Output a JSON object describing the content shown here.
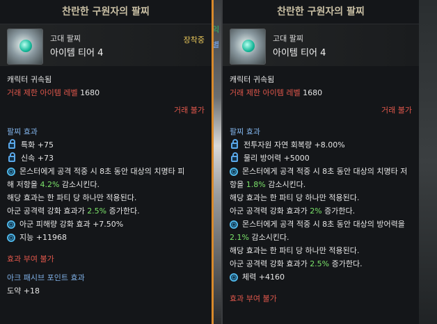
{
  "background": {
    "left_fragment": "익",
    "blue_fragment": "별"
  },
  "left": {
    "title": "찬란한 구원자의 팔찌",
    "grade": "고대 팔찌",
    "tier": "아이템 티어 4",
    "equipped": "장착중",
    "bound": "캐릭터 귀속됨",
    "level_label": "거래 제한 아이템 레벨",
    "level_value": "1680",
    "trade": "거래 불가",
    "effects_title": "팔찌 효과",
    "stat1": "특화 +75",
    "stat2": "신속 +73",
    "eff1_a": "몬스터에게 공격 적중 시 8초 동안 대상의 치명타 피",
    "eff1_b_pre": "해 저항을 ",
    "eff1_b_val": "4.2%",
    "eff1_b_post": " 감소시킨다.",
    "eff1_c": "해당 효과는 한 파티 당 하나만 적용된다.",
    "eff1_d_pre": "아군 공격력 강화 효과가 ",
    "eff1_d_val": "2.5%",
    "eff1_d_post": " 증가한다.",
    "eff2": "아군 피해량 강화 효과 +7.50%",
    "eff3": "지능 +11968",
    "enchant": "효과 부여 불가",
    "ark_title": "아크 패시브 포인트 효과",
    "ark_value": "도약 +18"
  },
  "right": {
    "title": "찬란한 구원자의 팔찌",
    "grade": "고대 팔찌",
    "tier": "아이템 티어 4",
    "bound": "캐릭터 귀속됨",
    "level_label": "거래 제한 아이템 레벨",
    "level_value": "1680",
    "trade": "거래 불가",
    "effects_title": "팔찌 효과",
    "stat1": "전투자원 자연 회복량 +8.00%",
    "stat2": "물리 방어력 +5000",
    "eff1_a": "몬스터에게 공격 적중 시 8초 동안 대상의 치명타 저",
    "eff1_b_pre": "항을 ",
    "eff1_b_val": "1.8%",
    "eff1_b_post": " 감소시킨다.",
    "eff1_c": "해당 효과는 한 파티 당 하나만 적용된다.",
    "eff1_d_pre": "아군 공격력 강화 효과가 ",
    "eff1_d_val": "2%",
    "eff1_d_post": " 증가한다.",
    "eff2_a": "몬스터에게 공격 적중 시 8초 동안 대상의 방어력을",
    "eff2_b_val": "2.1%",
    "eff2_b_post": " 감소시킨다.",
    "eff2_c": "해당 효과는 한 파티 당 하나만 적용된다.",
    "eff2_d_pre": "아군 공격력 강화 효과가 ",
    "eff2_d_val": "2.5%",
    "eff2_d_post": " 증가한다.",
    "eff3": "체력 +4160",
    "enchant": "효과 부여 불가"
  }
}
